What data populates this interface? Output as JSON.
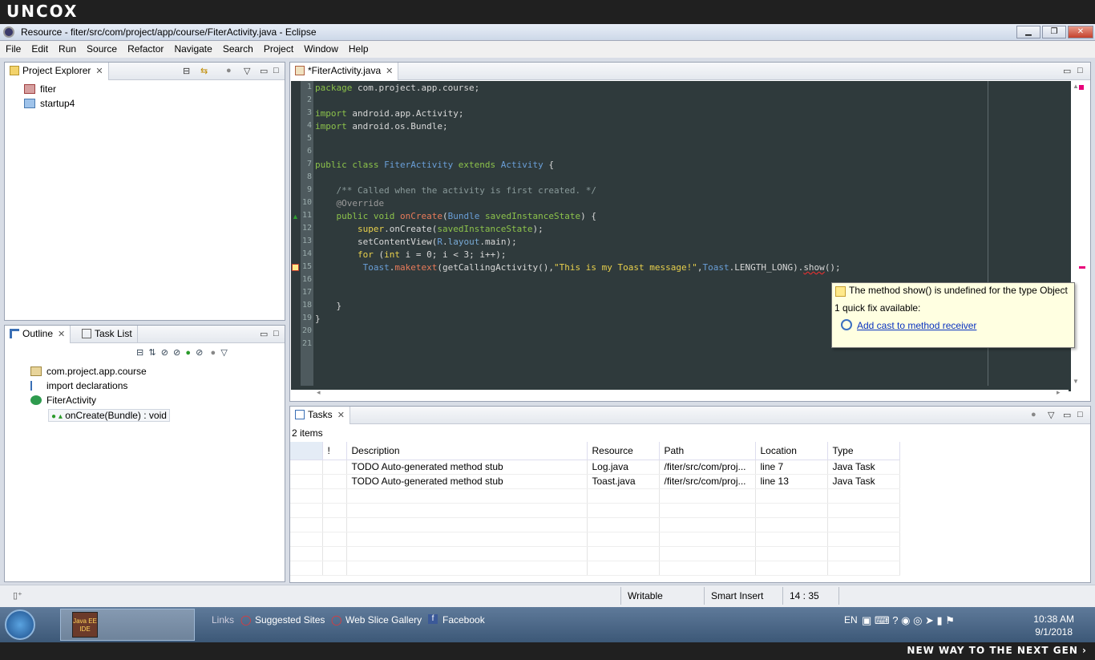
{
  "banner": {
    "top": "UNCOX",
    "bottom": "NEW WAY TO THE NEXT GEN ›"
  },
  "window": {
    "title": "Resource - fiter/src/com/project/app/course/FiterActivity.java - Eclipse",
    "min": "▁",
    "max": "❐",
    "close": "✕"
  },
  "menu": [
    "File",
    "Edit",
    "Run",
    "Source",
    "Refactor",
    "Navigate",
    "Search",
    "Project",
    "Window",
    "Help"
  ],
  "project_explorer": {
    "tab": "Project Explorer",
    "items": [
      "fiter",
      "startup4"
    ]
  },
  "outline": {
    "tab": "Outline",
    "tab2": "Task List",
    "items": [
      "com.project.app.course",
      "import declarations",
      "FiterActivity",
      "onCreate(Bundle) : void"
    ]
  },
  "editor": {
    "tab": "*FiterActivity.java",
    "lines": [
      "1",
      "2",
      "3",
      "4",
      "5",
      "6",
      "7",
      "8",
      "9",
      "10",
      "11",
      "12",
      "13",
      "14",
      "15",
      "16",
      "17",
      "18",
      "19",
      "20",
      "21"
    ],
    "code": {
      "l1a": "package",
      "l1b": " com.project.app.course;",
      "l3a": "import",
      "l3b": " android.app.Activity;",
      "l4a": "import",
      "l4b": " android.os.Bundle;",
      "l7a": "public class ",
      "l7b": "FiterActivity",
      "l7c": " extends ",
      "l7d": "Activity",
      "l7e": " {",
      "l9": "    /** Called when the activity is first created. */",
      "l10": "    @Override",
      "l11a": "    public void ",
      "l11b": "onCreate",
      "l11c": "(",
      "l11d": "Bundle",
      "l11e": " savedInstanceState",
      "l11f": ") {",
      "l12a": "        super",
      "l12b": ".onCreate(",
      "l12c": "savedInstanceState",
      "l12d": ");",
      "l13a": "        setContentView(",
      "l13b": "R",
      "l13c": ".",
      "l13d": "layout",
      "l13e": ".main);",
      "l14a": "        for",
      "l14b": " (",
      "l14c": "int",
      "l14d": " i = 0; i < 3; i++);",
      "l15a": "         Toast",
      "l15b": ".",
      "l15c": "maketext",
      "l15d": "(getCallingActivity(),",
      "l15e": "\"This is my Toast message!\"",
      "l15f": ",",
      "l15g": "Toast",
      "l15h": ".LENGTH_LONG).",
      "l15i": "show",
      "l15j": "();",
      "l18": "    }",
      "l19": "}"
    },
    "hover": {
      "message": "The method show() is undefined for the type Object",
      "fixes": "1 quick fix available:",
      "fix": "Add cast to method receiver"
    }
  },
  "tasks": {
    "tab": "Tasks",
    "count": "2 items",
    "headers": [
      "!",
      "Description",
      "Resource",
      "Path",
      "Location",
      "Type"
    ],
    "rows": [
      [
        "",
        "TODO Auto-generated method stub",
        "Log.java",
        "/fiter/src/com/proj...",
        "line 7",
        "Java Task"
      ],
      [
        "",
        "TODO Auto-generated method stub",
        "Toast.java",
        "/fiter/src/com/proj...",
        "line 13",
        "Java Task"
      ]
    ]
  },
  "status": {
    "writable": "Writable",
    "insert": "Smart Insert",
    "position": "14 : 35"
  },
  "taskbar": {
    "app": "Java EE IDE",
    "links": "Links",
    "l1": "Suggested Sites",
    "l2": "Web Slice Gallery",
    "l3": "Facebook",
    "lang": "EN",
    "time": "10:38 AM",
    "date": "9/1/2018"
  }
}
